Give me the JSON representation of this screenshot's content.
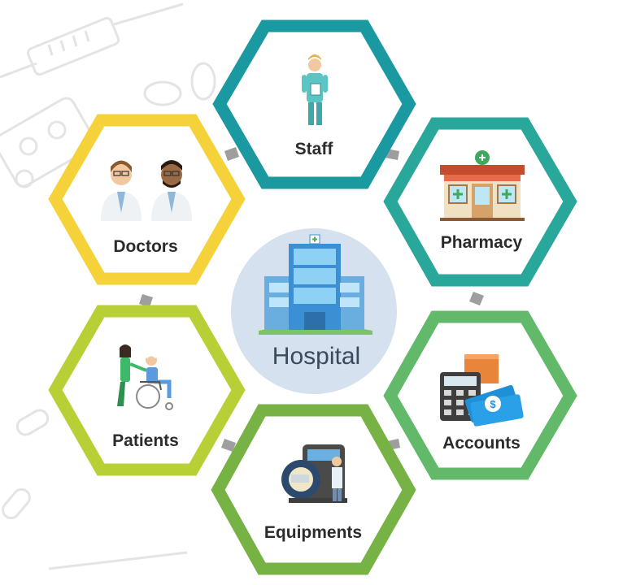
{
  "center": {
    "label": "Hospital",
    "icon": "hospital-building-icon"
  },
  "nodes": [
    {
      "key": "staff",
      "label": "Staff",
      "icon": "nurse-icon",
      "color": "#1A9AA0"
    },
    {
      "key": "pharmacy",
      "label": "Pharmacy",
      "icon": "pharmacy-store-icon",
      "color": "#2AA79B"
    },
    {
      "key": "accounts",
      "label": "Accounts",
      "icon": "calculator-cash-icon",
      "color": "#63B96A"
    },
    {
      "key": "equipments",
      "label": "Equipments",
      "icon": "mri-scanner-icon",
      "color": "#77B245"
    },
    {
      "key": "patients",
      "label": "Patients",
      "icon": "wheelchair-patient-icon",
      "color": "#B8CF36"
    },
    {
      "key": "doctors",
      "label": "Doctors",
      "icon": "doctors-icon",
      "color": "#F5D239"
    }
  ],
  "colors": {
    "connector": "#9e9e9e",
    "center_fill": "#d5e1ee",
    "sketch": "#e6e6e6"
  }
}
